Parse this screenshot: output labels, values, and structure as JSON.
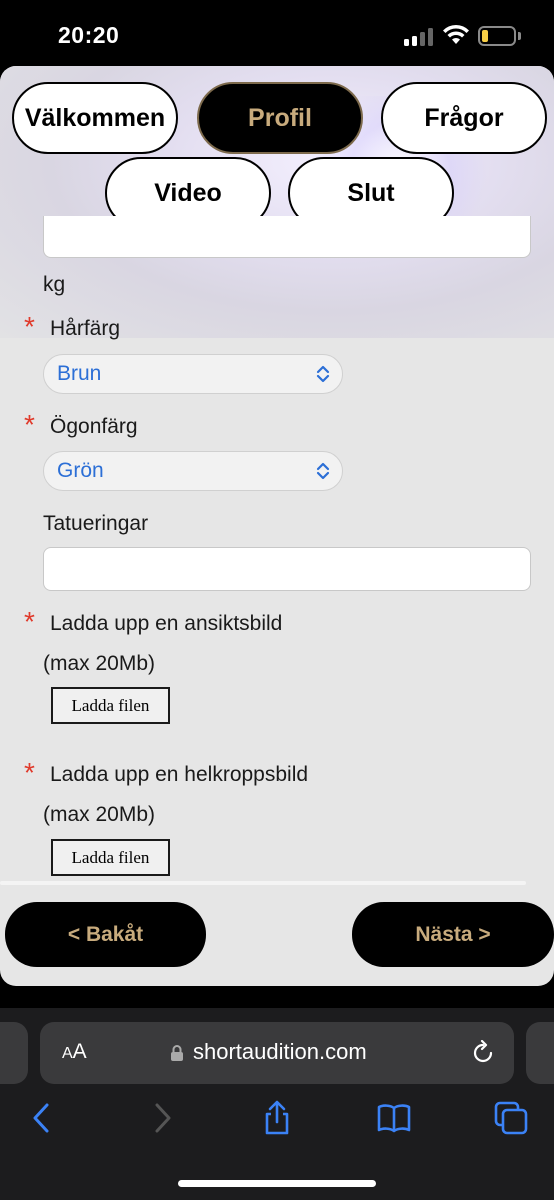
{
  "status_bar": {
    "time": "20:20"
  },
  "tabs": [
    {
      "label": "Välkommen",
      "active": false
    },
    {
      "label": "Profil",
      "active": true
    },
    {
      "label": "Frågor",
      "active": false
    },
    {
      "label": "Video",
      "active": false
    },
    {
      "label": "Slut",
      "active": false
    }
  ],
  "form": {
    "weight_unit": "kg",
    "hair_color": {
      "label": "Hårfärg",
      "value": "Brun",
      "required_mark": "*"
    },
    "eye_color": {
      "label": "Ögonfärg",
      "value": "Grön",
      "required_mark": "*"
    },
    "tattoos": {
      "label": "Tatueringar",
      "value": ""
    },
    "face_photo": {
      "label": "Ladda upp en ansiktsbild",
      "hint": "(max 20Mb)",
      "button": "Ladda filen",
      "required_mark": "*"
    },
    "body_photo": {
      "label": "Ladda upp en helkroppsbild",
      "hint": "(max 20Mb)",
      "button": "Ladda filen",
      "required_mark": "*"
    }
  },
  "nav": {
    "back": "< Bakåt",
    "next": "Nästa >"
  },
  "browser": {
    "aa_small": "A",
    "aa_big": "A",
    "url": "shortaudition.com"
  },
  "colors": {
    "accent_gold": "#c8ab7d",
    "select_text": "#2c6fd6",
    "required": "#e03a2b",
    "safari_icon": "#3b82f6"
  }
}
